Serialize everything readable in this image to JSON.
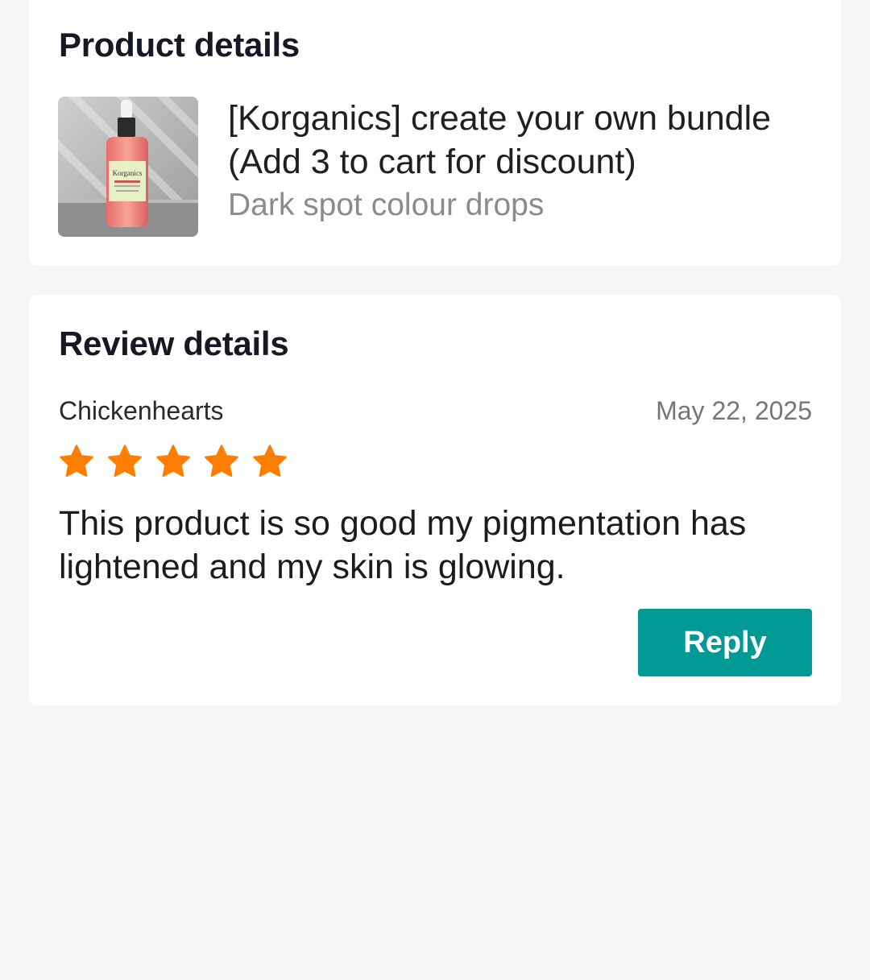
{
  "product_section": {
    "title": "Product details",
    "product_name": "[Korganics] create your own bundle (Add 3 to cart for discount)",
    "variant": "Dark spot colour drops",
    "thumbnail_icon": "serum-bottle-product-photo",
    "thumbnail_label": "Korganics"
  },
  "review_section": {
    "title": "Review details",
    "reviewer": "Chickenhearts",
    "date": "May 22, 2025",
    "rating": 5,
    "rating_max": 5,
    "star_color": "#ff7d00",
    "text": "This product is so good my pigmentation has lightened and my skin is glowing.",
    "reply_label": "Reply",
    "reply_color": "#009994"
  }
}
